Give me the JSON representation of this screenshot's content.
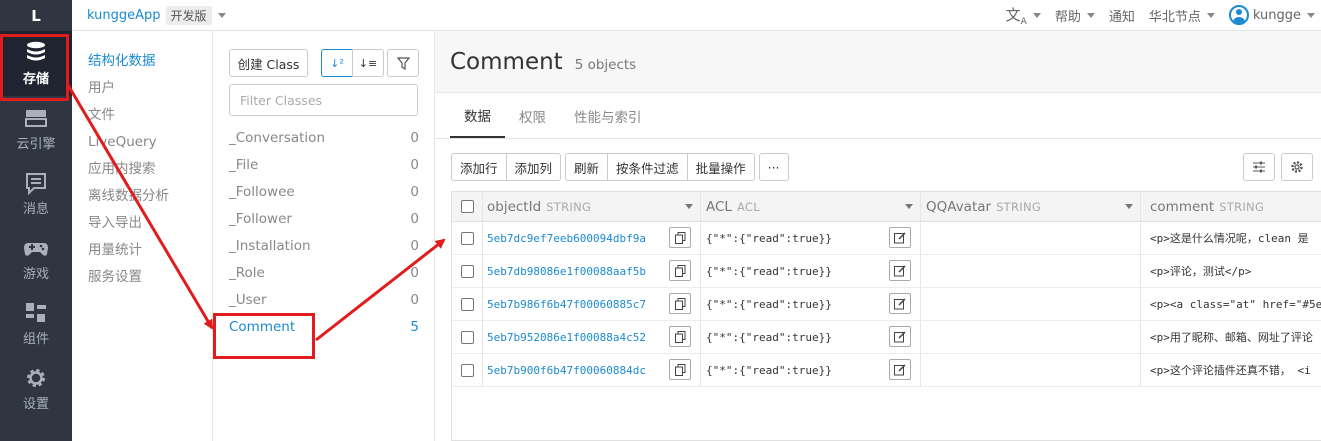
{
  "rail": {
    "logo": "L",
    "items": [
      {
        "label": "存储",
        "icon": "database-icon"
      },
      {
        "label": "云引擎",
        "icon": "server-icon"
      },
      {
        "label": "消息",
        "icon": "message-icon"
      },
      {
        "label": "游戏",
        "icon": "gamepad-icon"
      },
      {
        "label": "组件",
        "icon": "components-icon"
      },
      {
        "label": "设置",
        "icon": "gear-icon"
      }
    ]
  },
  "topbar": {
    "app_name": "kunggeApp",
    "app_badge": "开发版",
    "language_icon": "translate-icon",
    "help": "帮助",
    "notify": "通知",
    "region": "华北节点",
    "user": "kungge"
  },
  "subnav": {
    "items": [
      "结构化数据",
      "用户",
      "文件",
      "LiveQuery",
      "应用内搜索",
      "离线数据分析",
      "导入导出",
      "用量统计",
      "服务设置"
    ]
  },
  "classes": {
    "create_label": "创建 Class",
    "filter_placeholder": "Filter Classes",
    "list": [
      {
        "name": "_Conversation",
        "count": "0"
      },
      {
        "name": "_File",
        "count": "0"
      },
      {
        "name": "_Followee",
        "count": "0"
      },
      {
        "name": "_Follower",
        "count": "0"
      },
      {
        "name": "_Installation",
        "count": "0"
      },
      {
        "name": "_Role",
        "count": "0"
      },
      {
        "name": "_User",
        "count": "0"
      },
      {
        "name": "Comment",
        "count": "5"
      }
    ]
  },
  "main": {
    "title": "Comment",
    "count": "5 objects",
    "tabs": [
      "数据",
      "权限",
      "性能与索引"
    ],
    "toolbar": {
      "add_row": "添加行",
      "add_col": "添加列",
      "refresh": "刷新",
      "filter": "按条件过滤",
      "batch": "批量操作",
      "more": "···"
    },
    "columns": [
      {
        "name": "objectId",
        "type": "STRING"
      },
      {
        "name": "ACL",
        "type": "ACL"
      },
      {
        "name": "QQAvatar",
        "type": "STRING"
      },
      {
        "name": "comment",
        "type": "STRING"
      }
    ],
    "rows": [
      {
        "objectId": "5eb7dc9ef7eeb600094dbf9a",
        "acl": "{\"*\":{\"read\":true}}",
        "qq": "",
        "comment": "<p>这是什么情况呢，clean 是"
      },
      {
        "objectId": "5eb7db98086e1f00088aaf5b",
        "acl": "{\"*\":{\"read\":true}}",
        "qq": "",
        "comment": "<p>评论，测试</p>"
      },
      {
        "objectId": "5eb7b986f6b47f00060885c7",
        "acl": "{\"*\":{\"read\":true}}",
        "qq": "",
        "comment": "<p><a class=\"at\" href=\"#5e"
      },
      {
        "objectId": "5eb7b952086e1f00088a4c52",
        "acl": "{\"*\":{\"read\":true}}",
        "qq": "",
        "comment": "<p>用了昵称、邮箱、网址了评论"
      },
      {
        "objectId": "5eb7b900f6b47f00060884dc",
        "acl": "{\"*\":{\"read\":true}}",
        "qq": "",
        "comment": "<p>这个评论插件还真不错， <i"
      }
    ]
  },
  "colors": {
    "accent": "#1b8ad1",
    "rail_bg": "#2f3541",
    "annotation": "#e01c1c"
  }
}
